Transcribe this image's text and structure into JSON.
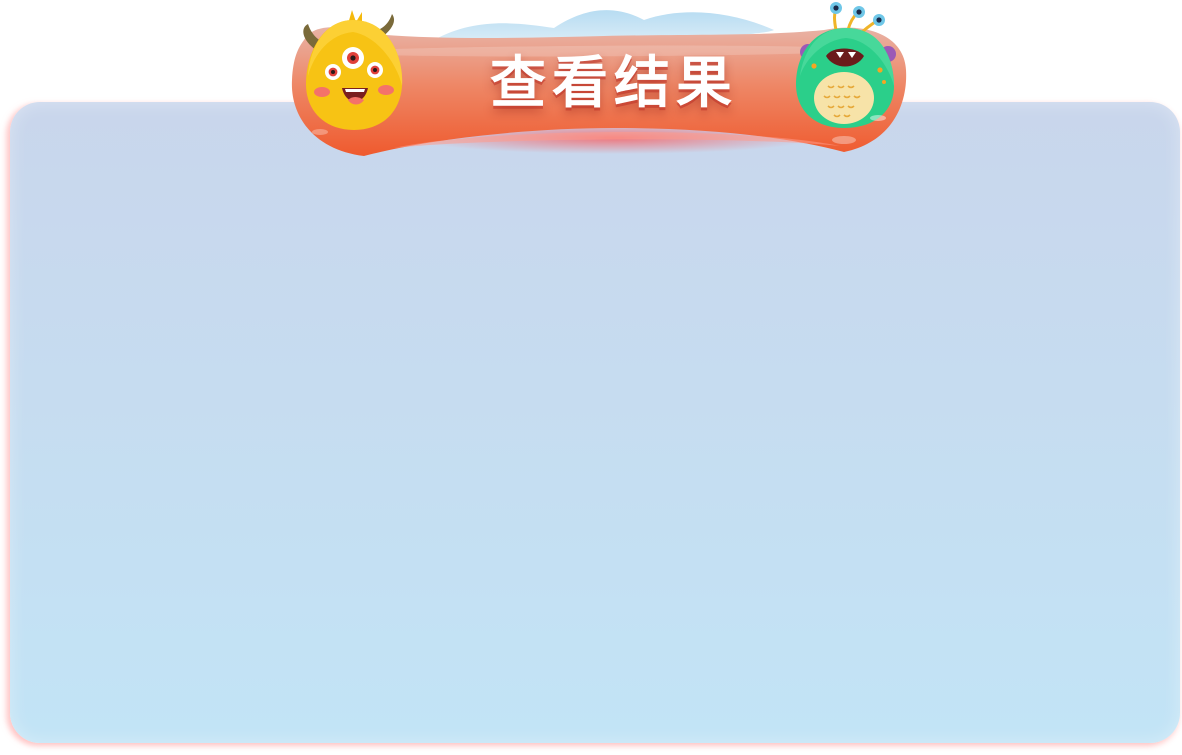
{
  "header": {
    "title": "查看结果"
  },
  "mascots": {
    "left": {
      "icon": "yellow-three-eyed-monster-icon"
    },
    "right": {
      "icon": "green-antenna-monster-icon"
    }
  },
  "colors": {
    "banner_top": "#e9a08f",
    "banner_bottom": "#ef5a2e",
    "panel_top": "#c9d6ec",
    "panel_bottom": "#c2e4f6",
    "title_text": "#ffffff"
  }
}
